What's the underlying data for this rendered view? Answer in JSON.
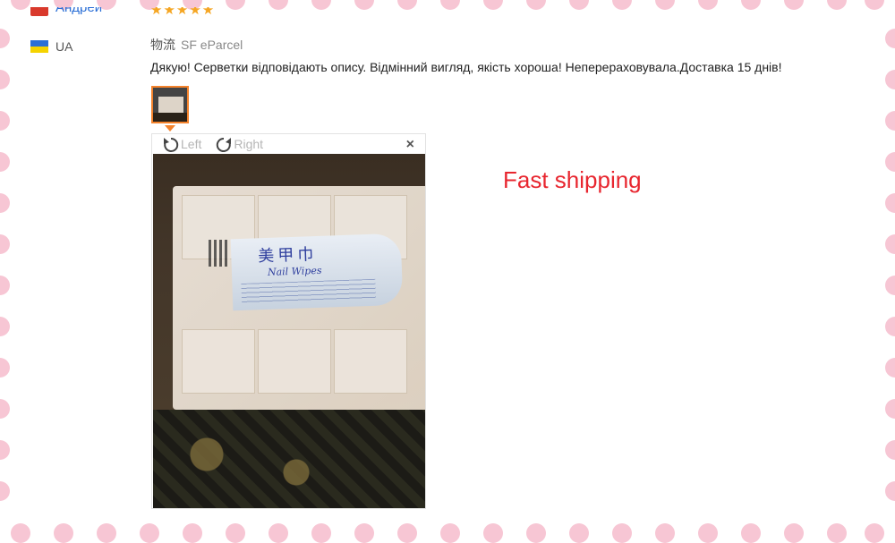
{
  "header_cut": {
    "country_partial": "Андрей",
    "stars": "★★★★★"
  },
  "country": {
    "code": "UA",
    "flag_colors": [
      "#2b6fd6",
      "#f5d300"
    ]
  },
  "logistics": {
    "label": "物流",
    "value": "SF eParcel"
  },
  "review": {
    "text": "Дякую! Серветки відповідають опису. Відмінний вигляд, якість хороша! Неперераховувала.Доставка 15 днів!"
  },
  "viewer": {
    "rotate_left_label": "Left",
    "rotate_right_label": "Right",
    "close_glyph": "×",
    "photo_label_title": "美甲巾",
    "photo_label_sub": "Nail Wipes"
  },
  "banner": {
    "text": "Fast shipping",
    "color": "#e8262f"
  },
  "accent_color": "#f4832c"
}
